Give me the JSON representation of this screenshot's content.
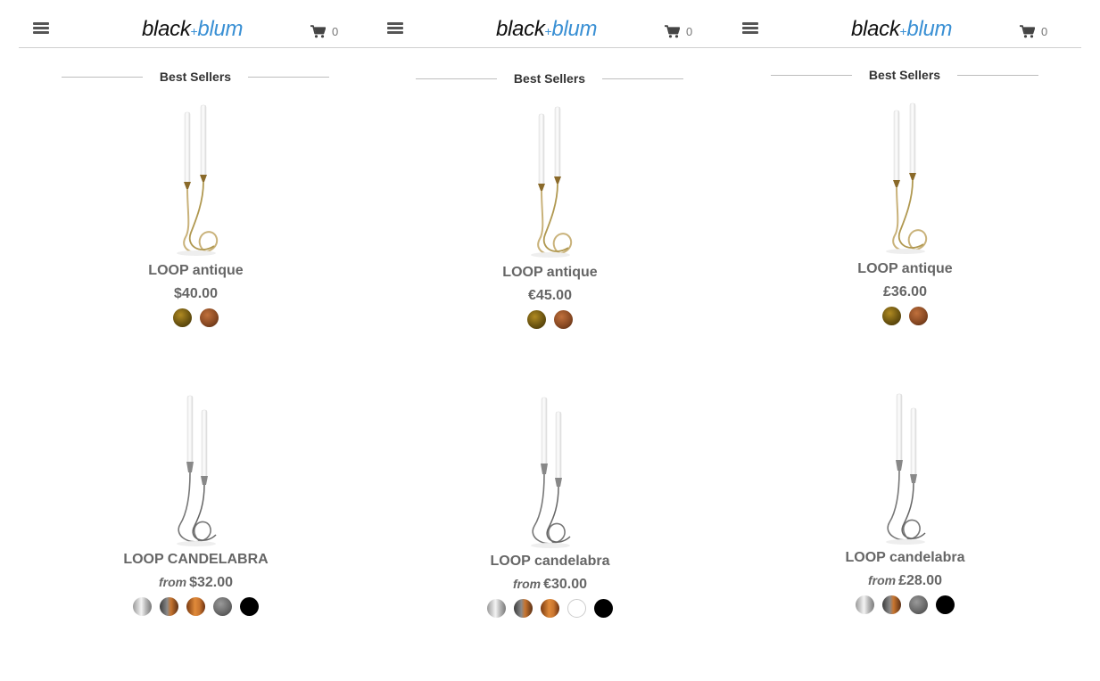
{
  "columns": [
    {
      "header": {
        "logo_black": "black",
        "logo_plus": "+",
        "logo_blum": "blum",
        "cart_count": "0"
      },
      "section_title": "Best Sellers",
      "products": [
        {
          "name": "LOOP antique",
          "from_label": "",
          "price": "$40.00",
          "swatches": [
            "brass",
            "copper"
          ]
        },
        {
          "name": "LOOP CANDELABRA",
          "from_label": "from",
          "price": "$32.00",
          "swatches": [
            "silver",
            "gunmetal-copper",
            "copper",
            "graphite",
            "black"
          ]
        }
      ]
    },
    {
      "header": {
        "logo_black": "black",
        "logo_plus": "+",
        "logo_blum": "blum",
        "cart_count": "0"
      },
      "section_title": "Best Sellers",
      "products": [
        {
          "name": "LOOP antique",
          "from_label": "",
          "price": "€45.00",
          "swatches": [
            "brass",
            "copper"
          ]
        },
        {
          "name": "LOOP candelabra",
          "from_label": "from",
          "price": "€30.00",
          "swatches": [
            "silver",
            "gunmetal-copper",
            "copper",
            "white",
            "black"
          ]
        }
      ]
    },
    {
      "header": {
        "logo_black": "black",
        "logo_plus": "+",
        "logo_blum": "blum",
        "cart_count": "0"
      },
      "section_title": "Best Sellers",
      "products": [
        {
          "name": "LOOP antique",
          "from_label": "",
          "price": "£36.00",
          "swatches": [
            "brass",
            "copper"
          ]
        },
        {
          "name": "LOOP candelabra",
          "from_label": "from",
          "price": "£28.00",
          "swatches": [
            "silver",
            "gunmetal-copper",
            "graphite",
            "black"
          ]
        }
      ]
    }
  ],
  "icons": {
    "menu": "hamburger-menu-icon",
    "cart": "shopping-cart-icon"
  },
  "colors": {
    "brand_black": "#111111",
    "brand_blue": "#3a90d4",
    "text_grey": "#666666",
    "swatch_brass": "#6b5410",
    "swatch_copper": "#8a4a23",
    "swatch_silver": "#cfcfcf",
    "swatch_graphite": "#6e6e6e",
    "swatch_orange_copper": "#c9752f",
    "swatch_white": "#ffffff",
    "swatch_black": "#000000"
  }
}
